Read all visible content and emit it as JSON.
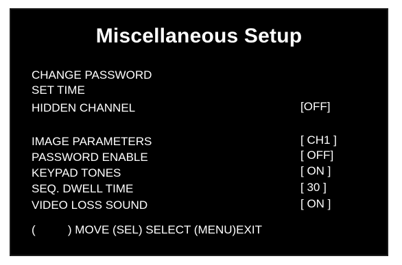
{
  "menu": {
    "title": "Miscellaneous Setup",
    "items": [
      {
        "label": "CHANGE PASSWORD",
        "value": ""
      },
      {
        "label": "SET TIME",
        "value": ""
      },
      {
        "label": "HIDDEN CHANNEL",
        "value": "[OFF]"
      },
      {
        "label": "IMAGE PARAMETERS",
        "value": "[ CH1 ]"
      },
      {
        "label": "PASSWORD ENABLE",
        "value": "[ OFF]"
      },
      {
        "label": "KEYPAD TONES",
        "value": "[ ON ]"
      },
      {
        "label": "SEQ. DWELL TIME",
        "value": "[ 30 ]"
      },
      {
        "label": "VIDEO LOSS SOUND",
        "value": "[ ON ]"
      }
    ],
    "footer": "(          ) MOVE (SEL) SELECT (MENU)EXIT"
  },
  "colors": {
    "background": "#000000",
    "text": "#ffffff",
    "page": "#ffffff"
  }
}
